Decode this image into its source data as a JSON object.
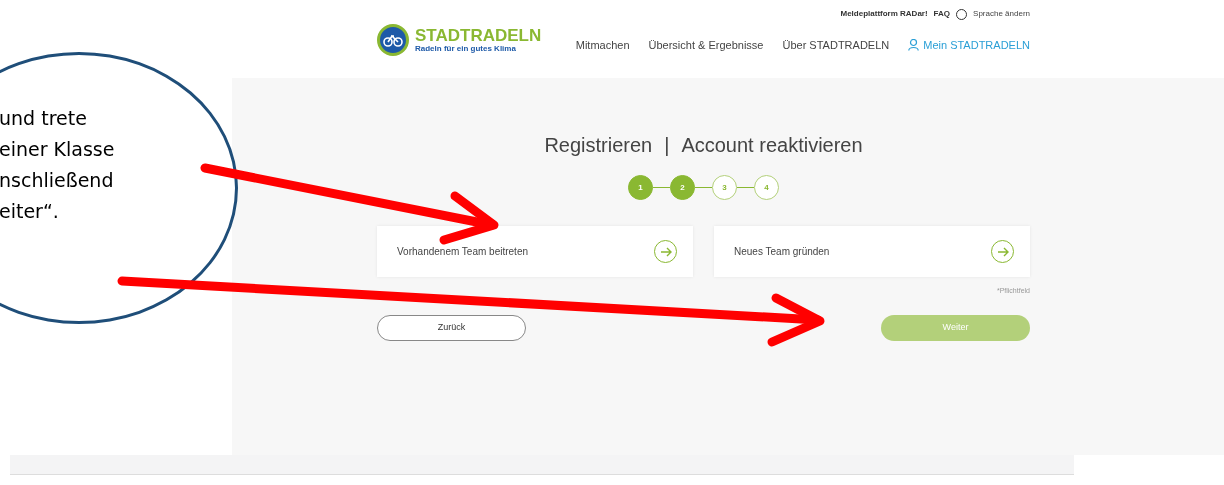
{
  "top_links": [
    "Meldeplattform RADar!",
    "FAQ",
    "Sprache ändern"
  ],
  "logo": {
    "name": "STADTRADELN",
    "tagline": "Radeln für ein gutes Klima"
  },
  "nav": [
    {
      "label": "Mitmachen",
      "selected": false
    },
    {
      "label": "Übersicht & Ergebnisse",
      "selected": false
    },
    {
      "label": "Über STADTRADELN",
      "selected": false
    },
    {
      "label": "Mein STADTRADELN",
      "selected": true
    }
  ],
  "title": {
    "left": "Registrieren",
    "separator": "|",
    "right": "Account reaktivieren"
  },
  "steps": [
    {
      "label": "1",
      "completed": true
    },
    {
      "label": "2",
      "completed": true
    },
    {
      "label": "3",
      "completed": false
    },
    {
      "label": "4",
      "completed": false
    }
  ],
  "options": [
    {
      "label": "Vorhandenem Team beitreten"
    },
    {
      "label": "Neues Team gründen"
    }
  ],
  "required_note": "*Pflichtfeld",
  "back_button": {
    "label": "Zurück"
  },
  "next_button": {
    "label": "Weiter",
    "disabled": true
  },
  "annotation": {
    "lines": [
      "und trete",
      "einer Klasse",
      "nschließend",
      "eiter“."
    ]
  }
}
